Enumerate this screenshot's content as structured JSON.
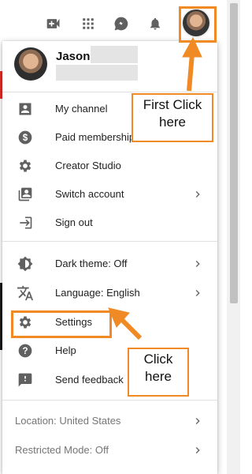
{
  "topbar": {
    "icons": [
      "video-camera-icon",
      "apps-grid-icon",
      "messages-icon",
      "bell-icon"
    ]
  },
  "menu": {
    "user_name": "Jason",
    "items": [
      {
        "label": "My channel",
        "icon": "person-box-icon"
      },
      {
        "label": "Paid memberships",
        "icon": "dollar-icon"
      },
      {
        "label": "Creator Studio",
        "icon": "gear-icon"
      },
      {
        "label": "Switch account",
        "icon": "switch-account-icon",
        "chevron": true
      },
      {
        "label": "Sign out",
        "icon": "sign-out-icon"
      },
      {
        "label": "Dark theme: Off",
        "icon": "dark-theme-icon",
        "chevron": true
      },
      {
        "label": "Language: English",
        "icon": "translate-icon",
        "chevron": true
      },
      {
        "label": "Settings",
        "icon": "gear-icon"
      },
      {
        "label": "Help",
        "icon": "help-icon"
      },
      {
        "label": "Send feedback",
        "icon": "feedback-icon"
      }
    ],
    "footer": [
      {
        "label": "Location: United States",
        "chevron": true
      },
      {
        "label": "Restricted Mode: Off",
        "chevron": true
      }
    ]
  },
  "annotations": {
    "first_click": "First Click here",
    "click_here": "Click here"
  },
  "colors": {
    "annotation": "#f08a24",
    "icon": "#606060",
    "brand_red": "#e52d27"
  }
}
